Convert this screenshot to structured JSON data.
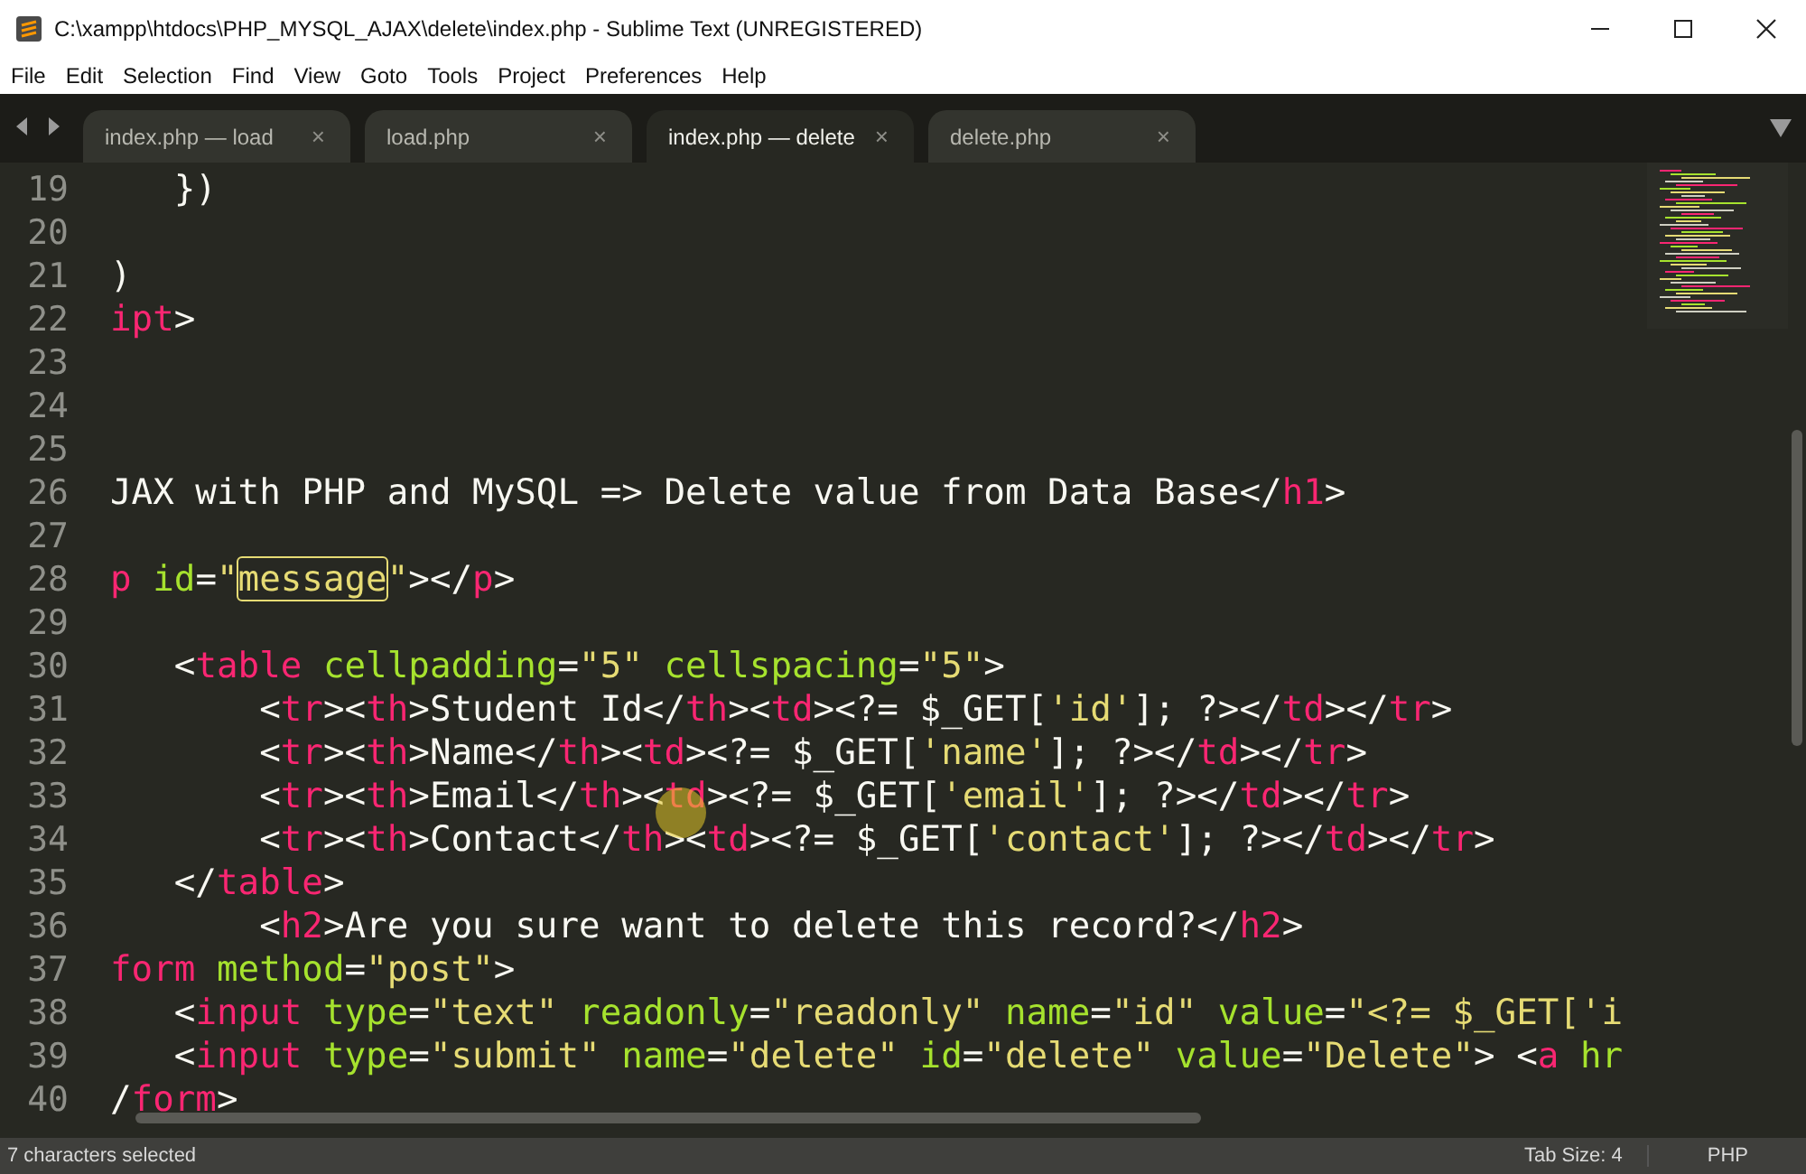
{
  "window": {
    "title": "C:\\xampp\\htdocs\\PHP_MYSQL_AJAX\\delete\\index.php - Sublime Text (UNREGISTERED)"
  },
  "menu": [
    "File",
    "Edit",
    "Selection",
    "Find",
    "View",
    "Goto",
    "Tools",
    "Project",
    "Preferences",
    "Help"
  ],
  "tabs": [
    {
      "label": "index.php — load",
      "selected": false
    },
    {
      "label": "load.php",
      "selected": false
    },
    {
      "label": "index.php — delete",
      "selected": true
    },
    {
      "label": "delete.php",
      "selected": false
    }
  ],
  "tab_close": "×",
  "lines": [
    {
      "number": "19",
      "tokens": [
        {
          "kind": "text",
          "text": "   })"
        }
      ]
    },
    {
      "number": "20"
    },
    {
      "number": "21",
      "tokens": [
        {
          "kind": "text",
          "text": ")"
        }
      ]
    },
    {
      "number": "22",
      "tokens": [
        {
          "kind": "tag",
          "text": "ipt"
        },
        {
          "kind": "text",
          "text": ">"
        }
      ]
    },
    {
      "number": "23"
    },
    {
      "number": "24"
    },
    {
      "number": "25"
    },
    {
      "number": "26",
      "tokens": [
        {
          "kind": "text",
          "text": "JAX with PHP and MySQL => Delete value from Data Base</"
        },
        {
          "kind": "tag",
          "text": "h1"
        },
        {
          "kind": "text",
          "text": ">"
        }
      ]
    },
    {
      "number": "27"
    },
    {
      "number": "28",
      "tokens": [
        {
          "kind": "tag",
          "text": "p"
        },
        {
          "kind": "attr",
          "text": " id"
        },
        {
          "kind": "text",
          "text": "="
        },
        {
          "kind": "str",
          "text": "\""
        },
        {
          "kind": "match",
          "text": "message"
        },
        {
          "kind": "str",
          "text": "\""
        },
        {
          "kind": "text",
          "text": "></"
        },
        {
          "kind": "tag",
          "text": "p"
        },
        {
          "kind": "text",
          "text": ">"
        }
      ]
    },
    {
      "number": "29"
    },
    {
      "number": "30",
      "tokens": [
        {
          "kind": "text",
          "text": "   <"
        },
        {
          "kind": "tag",
          "text": "table"
        },
        {
          "kind": "attr",
          "text": " cellpadding"
        },
        {
          "kind": "text",
          "text": "="
        },
        {
          "kind": "str",
          "text": "\"5\""
        },
        {
          "kind": "attr",
          "text": " cellspacing"
        },
        {
          "kind": "text",
          "text": "="
        },
        {
          "kind": "str",
          "text": "\"5\""
        },
        {
          "kind": "text",
          "text": ">"
        }
      ]
    },
    {
      "number": "31",
      "tokens": [
        {
          "kind": "text",
          "text": "       <"
        },
        {
          "kind": "tag",
          "text": "tr"
        },
        {
          "kind": "text",
          "text": "><"
        },
        {
          "kind": "tag",
          "text": "th"
        },
        {
          "kind": "text",
          "text": ">Student Id</"
        },
        {
          "kind": "tag",
          "text": "th"
        },
        {
          "kind": "text",
          "text": "><"
        },
        {
          "kind": "tag",
          "text": "td"
        },
        {
          "kind": "text",
          "text": "><?= $_GET["
        },
        {
          "kind": "str",
          "text": "'id'"
        },
        {
          "kind": "text",
          "text": "]; ?></"
        },
        {
          "kind": "tag",
          "text": "td"
        },
        {
          "kind": "text",
          "text": "></"
        },
        {
          "kind": "tag",
          "text": "tr"
        },
        {
          "kind": "text",
          "text": ">"
        }
      ]
    },
    {
      "number": "32",
      "tokens": [
        {
          "kind": "text",
          "text": "       <"
        },
        {
          "kind": "tag",
          "text": "tr"
        },
        {
          "kind": "text",
          "text": "><"
        },
        {
          "kind": "tag",
          "text": "th"
        },
        {
          "kind": "text",
          "text": ">Name</"
        },
        {
          "kind": "tag",
          "text": "th"
        },
        {
          "kind": "text",
          "text": "><"
        },
        {
          "kind": "tag",
          "text": "td"
        },
        {
          "kind": "text",
          "text": "><?= $_GET["
        },
        {
          "kind": "str",
          "text": "'name'"
        },
        {
          "kind": "text",
          "text": "]; ?></"
        },
        {
          "kind": "tag",
          "text": "td"
        },
        {
          "kind": "text",
          "text": "></"
        },
        {
          "kind": "tag",
          "text": "tr"
        },
        {
          "kind": "text",
          "text": ">"
        }
      ]
    },
    {
      "number": "33",
      "tokens": [
        {
          "kind": "text",
          "text": "       <"
        },
        {
          "kind": "tag",
          "text": "tr"
        },
        {
          "kind": "text",
          "text": "><"
        },
        {
          "kind": "tag",
          "text": "th"
        },
        {
          "kind": "text",
          "text": ">Email</"
        },
        {
          "kind": "tag",
          "text": "th"
        },
        {
          "kind": "text",
          "text": "><"
        },
        {
          "kind": "tag",
          "text": "td"
        },
        {
          "kind": "text",
          "text": "><?= $_GET["
        },
        {
          "kind": "str",
          "text": "'email'"
        },
        {
          "kind": "text",
          "text": "]; ?></"
        },
        {
          "kind": "tag",
          "text": "td"
        },
        {
          "kind": "text",
          "text": "></"
        },
        {
          "kind": "tag",
          "text": "tr"
        },
        {
          "kind": "text",
          "text": ">"
        }
      ]
    },
    {
      "number": "34",
      "tokens": [
        {
          "kind": "text",
          "text": "       <"
        },
        {
          "kind": "tag",
          "text": "tr"
        },
        {
          "kind": "text",
          "text": "><"
        },
        {
          "kind": "tag",
          "text": "th"
        },
        {
          "kind": "text",
          "text": ">Contact</"
        },
        {
          "kind": "tag",
          "text": "th"
        },
        {
          "kind": "text",
          "text": "><"
        },
        {
          "kind": "tag",
          "text": "td"
        },
        {
          "kind": "text",
          "text": "><?= $_GET["
        },
        {
          "kind": "str",
          "text": "'contact'"
        },
        {
          "kind": "text",
          "text": "]; ?></"
        },
        {
          "kind": "tag",
          "text": "td"
        },
        {
          "kind": "text",
          "text": "></"
        },
        {
          "kind": "tag",
          "text": "tr"
        },
        {
          "kind": "text",
          "text": ">"
        }
      ]
    },
    {
      "number": "35",
      "tokens": [
        {
          "kind": "text",
          "text": "   </"
        },
        {
          "kind": "tag",
          "text": "table"
        },
        {
          "kind": "text",
          "text": ">"
        }
      ]
    },
    {
      "number": "36",
      "tokens": [
        {
          "kind": "text",
          "text": "       <"
        },
        {
          "kind": "tag",
          "text": "h2"
        },
        {
          "kind": "text",
          "text": ">Are you sure want to delete this record?</"
        },
        {
          "kind": "tag",
          "text": "h2"
        },
        {
          "kind": "text",
          "text": ">"
        }
      ]
    },
    {
      "number": "37",
      "tokens": [
        {
          "kind": "tag",
          "text": "form"
        },
        {
          "kind": "attr",
          "text": " method"
        },
        {
          "kind": "text",
          "text": "="
        },
        {
          "kind": "str",
          "text": "\"post\""
        },
        {
          "kind": "text",
          "text": ">"
        }
      ]
    },
    {
      "number": "38",
      "tokens": [
        {
          "kind": "text",
          "text": "   <"
        },
        {
          "kind": "tag",
          "text": "input"
        },
        {
          "kind": "attr",
          "text": " type"
        },
        {
          "kind": "text",
          "text": "="
        },
        {
          "kind": "str",
          "text": "\"text\""
        },
        {
          "kind": "attr",
          "text": " readonly"
        },
        {
          "kind": "text",
          "text": "="
        },
        {
          "kind": "str",
          "text": "\"readonly\""
        },
        {
          "kind": "attr",
          "text": " name"
        },
        {
          "kind": "text",
          "text": "="
        },
        {
          "kind": "str",
          "text": "\"id\""
        },
        {
          "kind": "attr",
          "text": " value"
        },
        {
          "kind": "text",
          "text": "="
        },
        {
          "kind": "str",
          "text": "\"<?= $_GET['i"
        }
      ]
    },
    {
      "number": "39",
      "tokens": [
        {
          "kind": "text",
          "text": "   <"
        },
        {
          "kind": "tag",
          "text": "input"
        },
        {
          "kind": "attr",
          "text": " type"
        },
        {
          "kind": "text",
          "text": "="
        },
        {
          "kind": "str",
          "text": "\"submit\""
        },
        {
          "kind": "attr",
          "text": " name"
        },
        {
          "kind": "text",
          "text": "="
        },
        {
          "kind": "str",
          "text": "\"delete\""
        },
        {
          "kind": "attr",
          "text": " id"
        },
        {
          "kind": "text",
          "text": "="
        },
        {
          "kind": "str",
          "text": "\"delete\""
        },
        {
          "kind": "attr",
          "text": " value"
        },
        {
          "kind": "text",
          "text": "="
        },
        {
          "kind": "str",
          "text": "\"Delete\""
        },
        {
          "kind": "text",
          "text": "> <"
        },
        {
          "kind": "tag",
          "text": "a"
        },
        {
          "kind": "attr",
          "text": " hr"
        }
      ]
    },
    {
      "number": "40",
      "tokens": [
        {
          "kind": "text",
          "text": "/"
        },
        {
          "kind": "tag",
          "text": "form"
        },
        {
          "kind": "text",
          "text": ">"
        }
      ]
    }
  ],
  "status_bar": {
    "message": "7 characters selected",
    "tab_size": "Tab Size: 4",
    "syntax": "PHP"
  }
}
